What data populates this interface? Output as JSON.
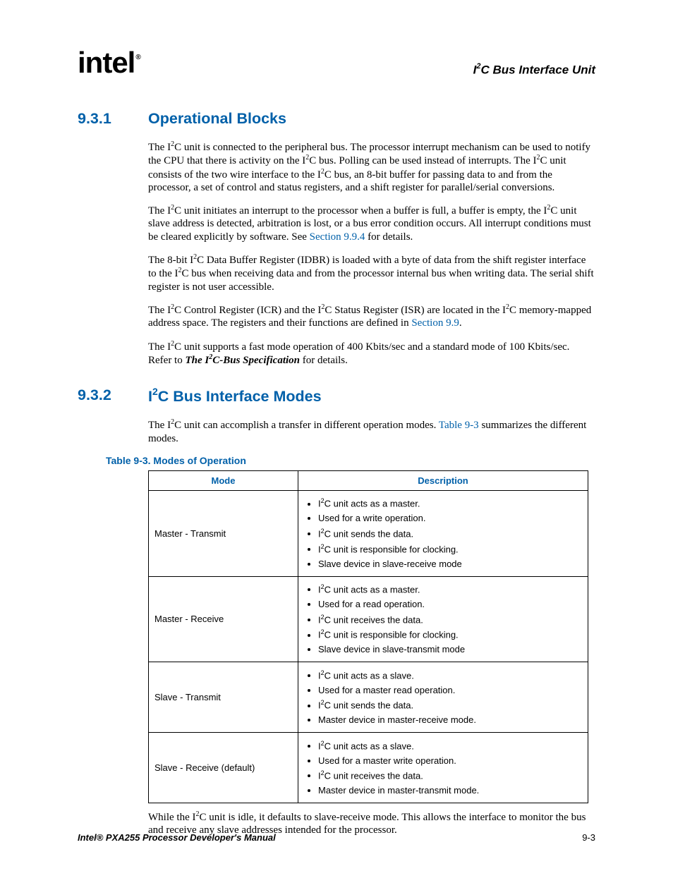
{
  "header": {
    "logo_text": "int",
    "logo_e": "e",
    "logo_l": "l",
    "logo_reg": "®",
    "page_title_pre": "I",
    "page_title_sup": "2",
    "page_title_post": "C Bus Interface Unit"
  },
  "sections": {
    "s1": {
      "num": "9.3.1",
      "title": "Operational Blocks"
    },
    "s2": {
      "num": "9.3.2",
      "title_pre": "I",
      "title_sup": "2",
      "title_post": "C Bus Interface Modes"
    }
  },
  "paras": {
    "p1a": "The I",
    "p1b": "C unit is connected to the peripheral bus. The processor interrupt mechanism can be used to notify the CPU that there is activity on the I",
    "p1c": "C bus. Polling can be used instead of interrupts. The I",
    "p1d": "C unit consists of the two wire interface to the I",
    "p1e": "C bus, an 8-bit buffer for passing data to and from the processor, a set of control and status registers, and a shift register for parallel/serial conversions.",
    "p2a": "The I",
    "p2b": "C unit initiates an interrupt to the processor when a buffer is full, a buffer is empty, the I",
    "p2c": "C unit slave address is detected, arbitration is lost, or a bus error condition occurs. All interrupt conditions must be cleared explicitly by software. See ",
    "p2link": "Section 9.9.4",
    "p2d": " for details.",
    "p3a": "The 8-bit I",
    "p3b": "C Data Buffer Register (IDBR) is loaded with a byte of data from the shift register interface to the I",
    "p3c": "C bus when receiving data and from the processor internal bus when writing data. The serial shift register is not user accessible.",
    "p4a": "The I",
    "p4b": "C Control Register (ICR) and the I",
    "p4c": "C Status Register (ISR) are located in the I",
    "p4d": "C memory-mapped address space. The registers and their functions are defined in ",
    "p4link": "Section 9.9",
    "p4e": ".",
    "p5a": "The I",
    "p5b": "C unit supports a fast mode operation of 400 Kbits/sec and a standard mode of 100 Kbits/sec. Refer to ",
    "p5spec_pre": "The I",
    "p5spec_post": "C-Bus Specification",
    "p5c": " for details.",
    "p6a": "The I",
    "p6b": "C unit can accomplish a transfer in different operation modes. ",
    "p6link": "Table 9-3",
    "p6c": " summarizes the different modes.",
    "p7a": "While the I",
    "p7b": "C unit is idle, it defaults to slave-receive mode. This allows the interface to monitor the bus and receive any slave addresses intended for the processor."
  },
  "table": {
    "caption": "Table 9-3. Modes of Operation",
    "headers": {
      "mode": "Mode",
      "desc": "Description"
    },
    "rows": [
      {
        "mode": "Master - Transmit",
        "items": [
          {
            "pre": "I",
            "sup": "2",
            "post": "C unit acts as a master."
          },
          {
            "text": "Used for a write operation."
          },
          {
            "pre": "I",
            "sup": "2",
            "post": "C unit sends the data."
          },
          {
            "pre": "I",
            "sup": "2",
            "post": "C unit is responsible for clocking."
          },
          {
            "text": "Slave device in slave-receive mode"
          }
        ]
      },
      {
        "mode": "Master - Receive",
        "items": [
          {
            "pre": "I",
            "sup": "2",
            "post": "C unit acts as a master."
          },
          {
            "text": "Used for a read operation."
          },
          {
            "pre": "I",
            "sup": "2",
            "post": "C unit receives the data."
          },
          {
            "pre": "I",
            "sup": "2",
            "post": "C unit is responsible for clocking."
          },
          {
            "text": "Slave device in slave-transmit mode"
          }
        ]
      },
      {
        "mode": "Slave - Transmit",
        "items": [
          {
            "pre": "I",
            "sup": "2",
            "post": "C unit acts as a slave."
          },
          {
            "text": "Used for a master read operation."
          },
          {
            "pre": "I",
            "sup": "2",
            "post": "C unit sends the data."
          },
          {
            "text": "Master device in master-receive mode."
          }
        ]
      },
      {
        "mode": "Slave - Receive (default)",
        "items": [
          {
            "pre": "I",
            "sup": "2",
            "post": "C unit acts as a slave."
          },
          {
            "text": "Used for a master write operation."
          },
          {
            "pre": "I",
            "sup": "2",
            "post": "C unit receives the data."
          },
          {
            "text": "Master device in master-transmit mode."
          }
        ]
      }
    ]
  },
  "footer": {
    "manual": "Intel® PXA255 Processor Developer's Manual",
    "page_num": "9-3"
  },
  "sup2": "2"
}
